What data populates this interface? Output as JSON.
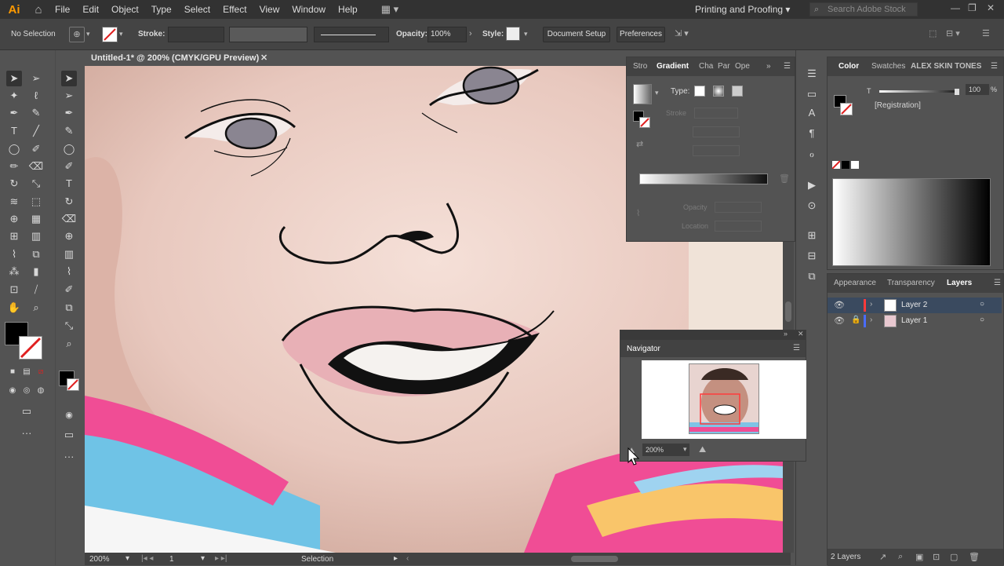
{
  "app": {
    "logo": "Ai",
    "menus": [
      "File",
      "Edit",
      "Object",
      "Type",
      "Select",
      "Effect",
      "View",
      "Window",
      "Help"
    ],
    "workspace": "Printing and Proofing",
    "search_placeholder": "Search Adobe Stock"
  },
  "control_bar": {
    "selection_label": "No Selection",
    "stroke_label": "Stroke:",
    "opacity_label": "Opacity:",
    "opacity_value": "100%",
    "style_label": "Style:",
    "document_setup": "Document Setup",
    "preferences": "Preferences"
  },
  "document": {
    "tab_title": "Untitled-1* @ 200% (CMYK/GPU Preview)"
  },
  "status_bar": {
    "zoom": "200%",
    "artboard": "1",
    "tool": "Selection"
  },
  "gradient_panel": {
    "tabs": [
      "Stro",
      "Gradient",
      "Cha",
      "Par",
      "Ope"
    ],
    "type_label": "Type:",
    "stroke_label": "Stroke",
    "opacity_label": "Opacity",
    "location_label": "Location"
  },
  "color_panel": {
    "tabs": [
      "Color",
      "Swatches",
      "ALEX SKIN TONES"
    ],
    "t_label": "T",
    "tint_value": "100",
    "percent": "%",
    "registration": "[Registration]"
  },
  "layers_panel": {
    "tabs": [
      "Appearance",
      "Transparency",
      "Layers"
    ],
    "layers": [
      {
        "name": "Layer 2",
        "color": "#ff3a3a"
      },
      {
        "name": "Layer 1",
        "color": "#4a6cff"
      }
    ],
    "count": "2 Layers"
  },
  "navigator": {
    "title": "Navigator",
    "zoom": "200%"
  }
}
